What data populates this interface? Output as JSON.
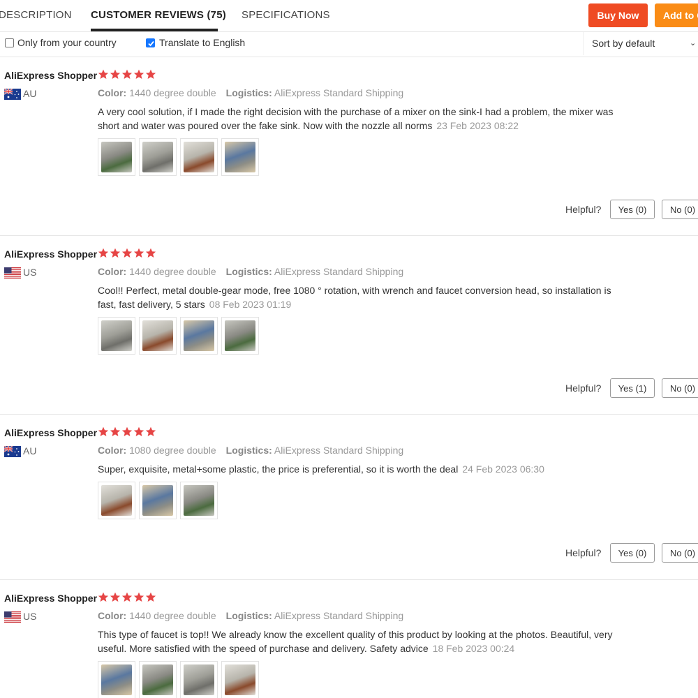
{
  "tabs": [
    {
      "label": "DESCRIPTION",
      "active": false
    },
    {
      "label": "CUSTOMER REVIEWS (75)",
      "active": true
    },
    {
      "label": "SPECIFICATIONS",
      "active": false
    }
  ],
  "actions": {
    "buy_now": "Buy Now",
    "add_to_cart": "Add to Cart"
  },
  "filters": {
    "only_country": {
      "label": "Only from your country",
      "checked": false
    },
    "translate": {
      "label": "Translate to English",
      "checked": true
    },
    "sort": {
      "selected": "Sort by default"
    }
  },
  "colors": {
    "accent_buy": "#ef4b23",
    "accent_cart": "#fa8c16",
    "star": "#e64545",
    "checkbox": "#1677ff"
  },
  "labels": {
    "color": "Color:",
    "logistics": "Logistics:",
    "helpful": "Helpful?"
  },
  "reviews": [
    {
      "author": "AliExpress Shopper",
      "rating": 5,
      "country": "AU",
      "color": "1440 degree double",
      "logistics": "AliExpress Standard Shipping",
      "text": "A very cool solution, if I made the right decision with the purchase of a mixer on the sink-I had a problem, the mixer was short and water was poured over the fake sink. Now with the nozzle all norms",
      "date": "23 Feb 2023 08:22",
      "photos": 4,
      "yes": "Yes (0)",
      "no": "No (0)"
    },
    {
      "author": "AliExpress Shopper",
      "rating": 5,
      "country": "US",
      "color": "1440 degree double",
      "logistics": "AliExpress Standard Shipping",
      "text": "Cool!! Perfect, metal double-gear mode, free 1080 ° rotation, with wrench and faucet conversion head, so installation is fast, fast delivery, 5 stars",
      "date": "08 Feb 2023 01:19",
      "photos": 4,
      "yes": "Yes (1)",
      "no": "No (0)"
    },
    {
      "author": "AliExpress Shopper",
      "rating": 5,
      "country": "AU",
      "color": "1080 degree double",
      "logistics": "AliExpress Standard Shipping",
      "text": "Super, exquisite, metal+some plastic, the price is preferential, so it is worth the deal",
      "date": "24 Feb 2023 06:30",
      "photos": 3,
      "yes": "Yes (0)",
      "no": "No (0)"
    },
    {
      "author": "AliExpress Shopper",
      "rating": 5,
      "country": "US",
      "color": "1440 degree double",
      "logistics": "AliExpress Standard Shipping",
      "text": "This type of faucet is top!! We already know the excellent quality of this product by looking at the photos. Beautiful, very useful. More satisfied with the speed of purchase and delivery. Safety advice",
      "date": "18 Feb 2023 00:24",
      "photos": 4
    }
  ]
}
